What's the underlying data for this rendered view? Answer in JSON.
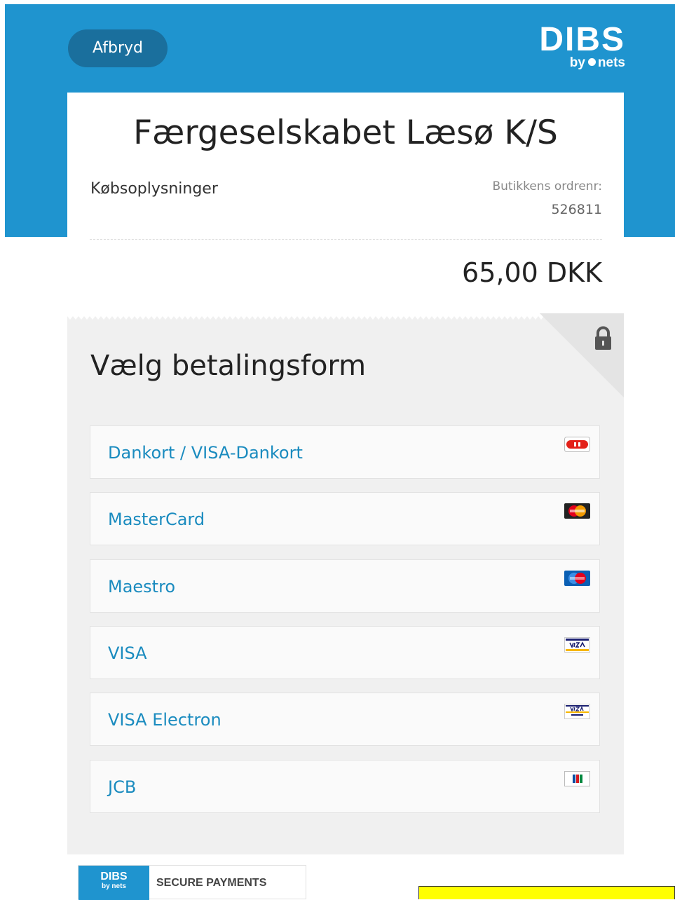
{
  "header": {
    "cancel_label": "Afbryd",
    "brand_name": "DIBS",
    "brand_by": "by",
    "brand_sub": "nets"
  },
  "order": {
    "merchant_name": "Færgeselskabet Læsø K/S",
    "purchase_info_label": "Købsoplysninger",
    "order_number_label": "Butikkens ordrenr:",
    "order_number": "526811",
    "amount": "65,00 DKK"
  },
  "payment": {
    "title": "Vælg betalingsform",
    "methods": [
      {
        "label": "Dankort / VISA-Dankort",
        "icon": "dankort-logo"
      },
      {
        "label": "MasterCard",
        "icon": "mastercard-logo"
      },
      {
        "label": "Maestro",
        "icon": "maestro-logo"
      },
      {
        "label": "VISA",
        "icon": "visa-logo"
      },
      {
        "label": "VISA Electron",
        "icon": "visa-electron-logo"
      },
      {
        "label": "JCB",
        "icon": "jcb-logo"
      }
    ]
  },
  "footer": {
    "badge_brand": "DIBS",
    "badge_sub": "by nets",
    "secure_text": "SECURE PAYMENTS"
  },
  "colors": {
    "header_blue": "#1f94cf",
    "cancel_button": "#1a6f9d",
    "link_blue": "#1a8bbf",
    "panel_grey": "#f0f0f0",
    "note_yellow": "#ffff00"
  }
}
